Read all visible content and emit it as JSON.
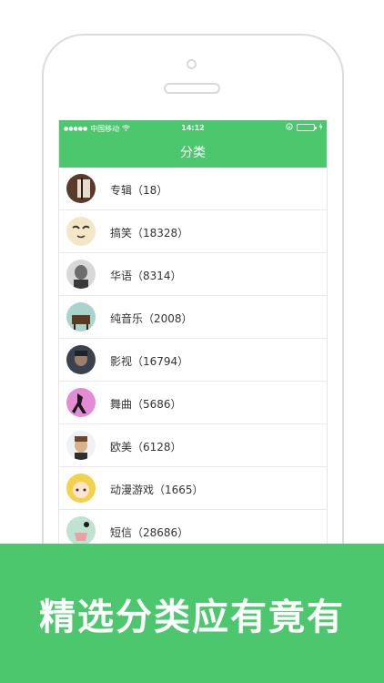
{
  "status_bar": {
    "carrier": "中国移动",
    "time": "14:12",
    "wifi_icon": "wifi-icon",
    "lock_icon": "rotation-lock-icon",
    "battery_icon": "battery-icon",
    "charging_icon": "charging-icon"
  },
  "header": {
    "title": "分类"
  },
  "categories": [
    {
      "label": "专辑（18）",
      "avatar_color": "#5a3a2a"
    },
    {
      "label": "搞笑（18328）",
      "avatar_color": "#f3e7c8"
    },
    {
      "label": "华语（8314）",
      "avatar_color": "#888888"
    },
    {
      "label": "纯音乐（2008）",
      "avatar_color": "#7fa7a0"
    },
    {
      "label": "影视（16794）",
      "avatar_color": "#3a4250"
    },
    {
      "label": "舞曲（5686）",
      "avatar_color": "#d94fb6"
    },
    {
      "label": "欧美（6128）",
      "avatar_color": "#d8b28a"
    },
    {
      "label": "动漫游戏（1665）",
      "avatar_color": "#f2d24a"
    },
    {
      "label": "短信（28686）",
      "avatar_color": "#bfe3d0"
    }
  ],
  "banner": {
    "text": "精选分类应有竟有"
  },
  "colors": {
    "accent": "#4cc76e"
  }
}
